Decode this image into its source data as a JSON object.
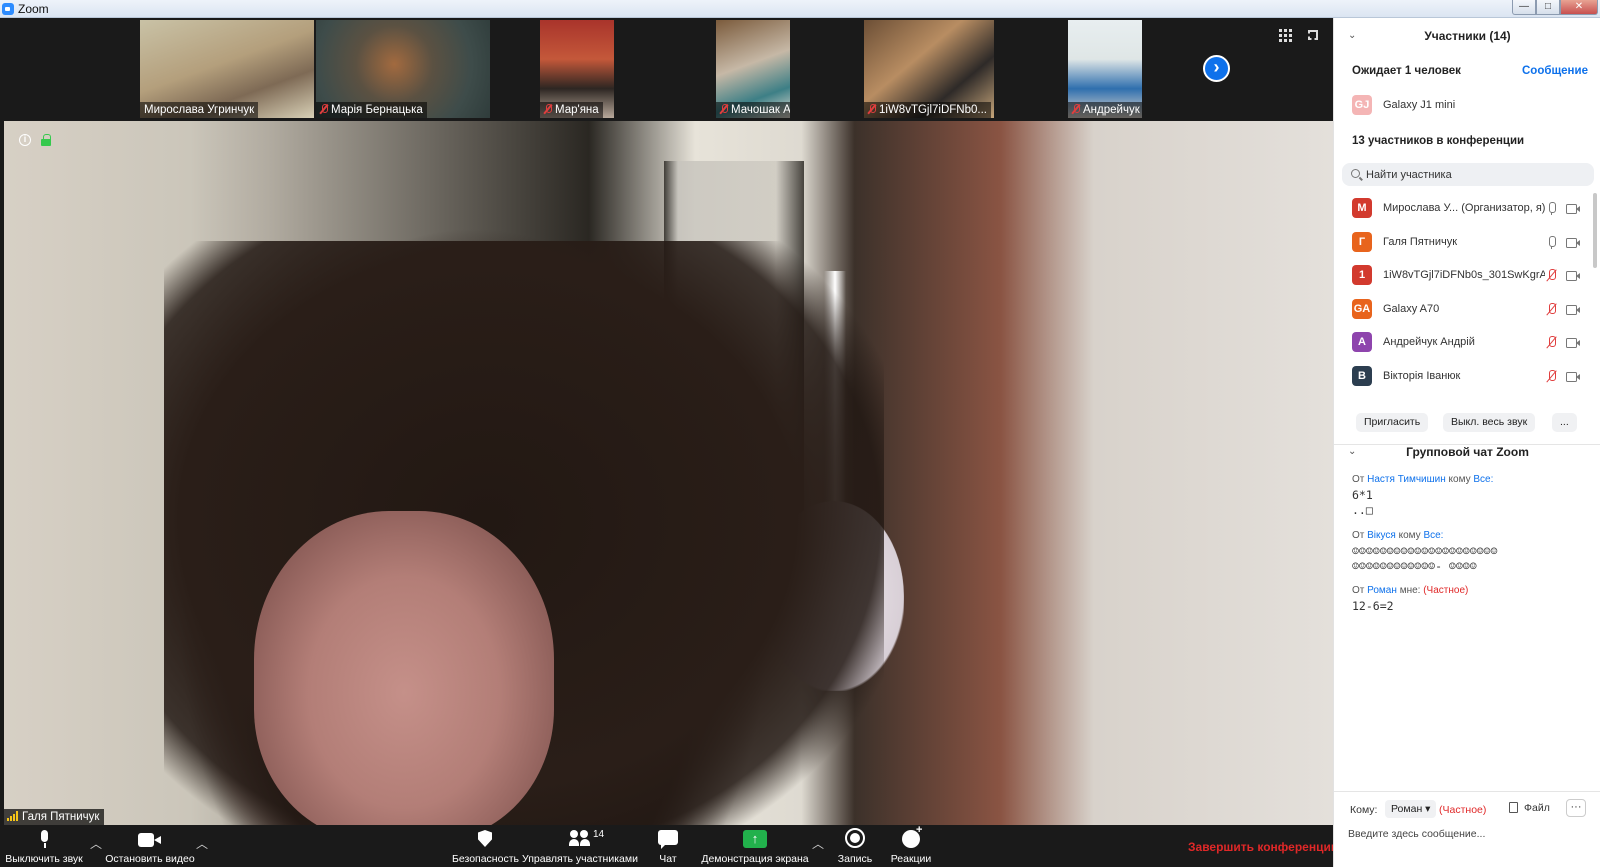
{
  "window": {
    "title": "Zoom",
    "controls": {
      "minimize": "—",
      "maximize": "□",
      "close": "✕"
    }
  },
  "thumbnails": [
    {
      "name": "Мирослава Угринчук",
      "muted": false
    },
    {
      "name": "Марія Бернацька",
      "muted": true
    },
    {
      "name": "Мар'яна",
      "muted": true
    },
    {
      "name": "Мачошак Артем",
      "muted": true
    },
    {
      "name": "1iW8vTGjl7iDFNb0...",
      "muted": true
    },
    {
      "name": "Андрейчук Андрій",
      "muted": true
    }
  ],
  "main_video": {
    "speaker": "Галя Пятничук"
  },
  "toolbar": {
    "mute_label": "Выключить звук",
    "video_label": "Остановить видео",
    "security_label": "Безопасность",
    "participants_label": "Управлять участниками",
    "participants_count": "14",
    "chat_label": "Чат",
    "share_label": "Демонстрация экрана",
    "record_label": "Запись",
    "reactions_label": "Реакции",
    "end_label": "Завершить конференцию",
    "share_arrow": "↑"
  },
  "participants_panel": {
    "title": "Участники (14)",
    "waiting_label": "Ожидает 1 человек",
    "message_link": "Сообщение",
    "waiting": {
      "initials": "GJ",
      "name": "Galaxy J1 mini",
      "color": "#f4b5b5"
    },
    "in_conference_label": "13 участников в конференции",
    "search_placeholder": "Найти участника",
    "list": [
      {
        "initials": "М",
        "name": "Мирослава У... (Организатор, я)",
        "color": "#d23a2e",
        "mic": "on"
      },
      {
        "initials": "Г",
        "name": "Галя Пятничук",
        "color": "#e8641d",
        "mic": "on"
      },
      {
        "initials": "1",
        "name": "1iW8vTGjl7iDFNb0s_301SwKgrA...",
        "color": "#d23a2e",
        "mic": "off"
      },
      {
        "initials": "GA",
        "name": "Galaxy A70",
        "color": "#e8641d",
        "mic": "off"
      },
      {
        "initials": "А",
        "name": "Андрейчук Андрій",
        "color": "#8e44ad",
        "mic": "off"
      },
      {
        "initials": "В",
        "name": "Вікторія Іванюк",
        "color": "#2c3e50",
        "mic": "off"
      }
    ],
    "invite_label": "Пригласить",
    "mute_all_label": "Выкл. весь звук",
    "more_label": "..."
  },
  "chat_panel": {
    "title": "Групповой чат Zoom",
    "messages": [
      {
        "from_prefix": "От",
        "from": "Настя Тимчишин",
        "to_prefix": "кому",
        "to": "Все:",
        "private": "",
        "body": "6*1\n..□"
      },
      {
        "from_prefix": "От",
        "from": "Вікуся",
        "to_prefix": "кому",
        "to": "Все:",
        "private": "",
        "body": "☺☺☺☺☺☺☺☺☺☺☺☺☺☺☺☺☺☺☺☺☺\n☺☺☺☺☺☺☺☺☺☺☺☺- ☺☺☺☺"
      },
      {
        "from_prefix": "От",
        "from": "Роман",
        "to_prefix": "мне:",
        "to": "",
        "private": "(Частное)",
        "body": "12-6=2"
      }
    ],
    "to_label": "Кому:",
    "to_value": "Роман ▾",
    "private_tag": "(Частное)",
    "file_label": "Файл",
    "more_label": "···",
    "input_placeholder": "Введите здесь сообщение..."
  }
}
